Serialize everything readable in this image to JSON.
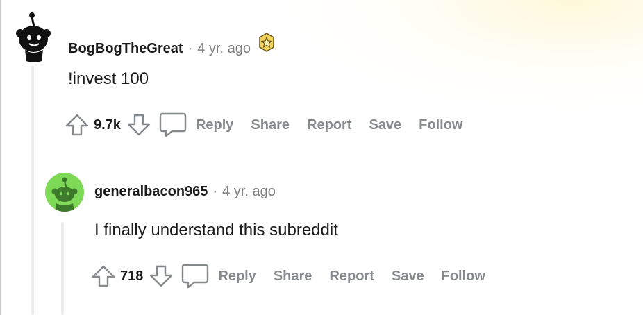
{
  "comments": [
    {
      "username": "BogBogTheGreat",
      "separator": "·",
      "time": "4 yr. ago",
      "award_icon": "gold-award-icon",
      "body": "!invest 100",
      "score": "9.7k",
      "actions": {
        "reply": "Reply",
        "share": "Share",
        "report": "Report",
        "save": "Save",
        "follow": "Follow"
      },
      "avatar_color": "#ffffff"
    },
    {
      "username": "generalbacon965",
      "separator": "·",
      "time": "4 yr. ago",
      "body": "I finally understand this subreddit",
      "score": "718",
      "actions": {
        "reply": "Reply",
        "share": "Share",
        "report": "Report",
        "save": "Save",
        "follow": "Follow"
      },
      "avatar_color": "#7ed957"
    }
  ],
  "colors": {
    "text": "#1c1c1c",
    "muted": "#7c7c7c",
    "action": "#878a8c",
    "thread_line": "#ededed"
  }
}
